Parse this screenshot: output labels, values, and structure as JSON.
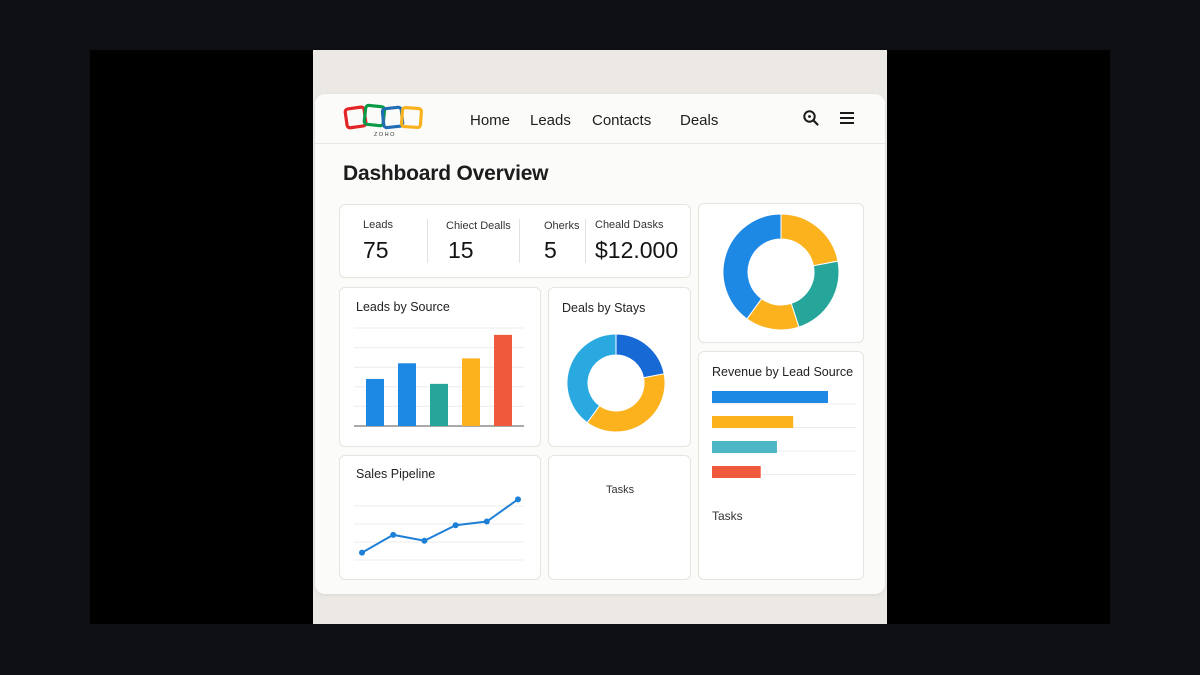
{
  "brand": {
    "logo_text": "ZOHO",
    "colors": [
      "#e42527",
      "#089949",
      "#226db4",
      "#f9b21d"
    ]
  },
  "nav": {
    "items": [
      {
        "label": "Home"
      },
      {
        "label": "Leads"
      },
      {
        "label": "Contacts"
      },
      {
        "label": "Deals"
      }
    ],
    "icons": [
      "search-icon",
      "menu-icon"
    ]
  },
  "page": {
    "title": "Dashboard Overview"
  },
  "kpis": [
    {
      "label": "Leads",
      "value": "75"
    },
    {
      "label": "Chiect Dealls",
      "value": "15"
    },
    {
      "label": "Oherks",
      "value": "5"
    },
    {
      "label": "Cheald Dasks",
      "value": "$12.000"
    }
  ],
  "cards": {
    "leads_by_source": "Leads by Source",
    "deals_by_stays": "Deals by Stays",
    "revenue_by_lead_source": "Revenue by Lead Source",
    "sales_pipeline": "Sales Pipeline",
    "tasks_center": "Tasks",
    "tasks_right": "Tasks"
  },
  "chart_data": [
    {
      "type": "bar",
      "title": "Leads by Source",
      "categories": [
        "",
        "",
        "",
        "",
        ""
      ],
      "values": [
        48,
        64,
        43,
        69,
        93
      ],
      "colors": [
        "#1e88e5",
        "#1e88e5",
        "#26a69a",
        "#fbb21d",
        "#ef5a3c"
      ],
      "ylim": [
        0,
        100
      ],
      "grid": true
    },
    {
      "type": "pie",
      "title": "Deals by Stays",
      "donut": true,
      "values": [
        22,
        38,
        40
      ],
      "colors": [
        "#1769d6",
        "#fbb21d",
        "#2aa9e0"
      ]
    },
    {
      "type": "pie",
      "title": "",
      "donut": true,
      "values": [
        22,
        23,
        15,
        40
      ],
      "colors": [
        "#fbb21d",
        "#26a69a",
        "#fbb21d",
        "#1e88e5"
      ]
    },
    {
      "type": "bar",
      "orientation": "horizontal",
      "title": "Revenue by Lead Source",
      "categories": [
        "",
        "",
        "",
        ""
      ],
      "values": [
        100,
        70,
        56,
        42
      ],
      "colors": [
        "#1e88e5",
        "#fbb21d",
        "#4db6c4",
        "#ef5a3c"
      ],
      "xlim": [
        0,
        100
      ],
      "grid": true
    },
    {
      "type": "line",
      "title": "Sales Pipeline",
      "x": [
        1,
        2,
        3,
        4,
        5,
        6
      ],
      "y": [
        10,
        34,
        26,
        47,
        52,
        82
      ],
      "ylim": [
        0,
        100
      ],
      "color": "#1e7fd6",
      "grid": true
    }
  ]
}
